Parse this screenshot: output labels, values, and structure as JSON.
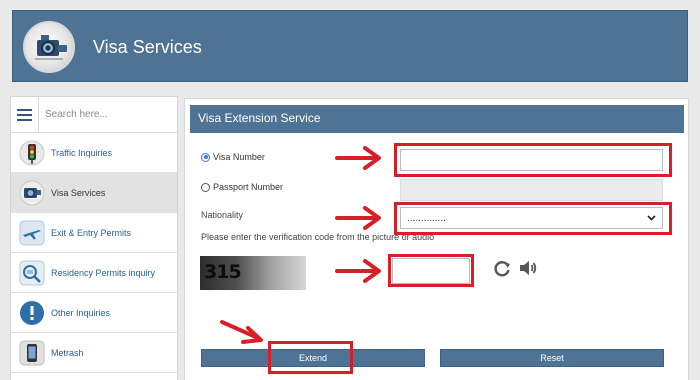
{
  "header": {
    "title": "Visa Services",
    "logo_icon": "camera-logo-icon",
    "color": "#4e7394"
  },
  "sidebar": {
    "menu_icon": "hamburger-icon",
    "search_placeholder": "Search here...",
    "items": [
      {
        "label": "Traffic Inquiries",
        "icon": "traffic-light-icon",
        "active": false
      },
      {
        "label": "Visa Services",
        "icon": "camera-icon",
        "active": true
      },
      {
        "label": "Exit & Entry Permits",
        "icon": "airplane-icon",
        "active": false
      },
      {
        "label": "Residency Permits inquiry",
        "icon": "id-card-icon",
        "active": false
      },
      {
        "label": "Other Inquiries",
        "icon": "info-icon",
        "active": false
      },
      {
        "label": "Metrash",
        "icon": "phone-icon",
        "active": false
      }
    ]
  },
  "form": {
    "title": "Visa Extension Service",
    "visa_number_label": "Visa Number",
    "passport_number_label": "Passport Number",
    "selected_option": "Visa Number",
    "nationality_label": "Nationality",
    "nationality_value": "..............",
    "verification_prompt": "Please enter the verification code from the picture or audio",
    "captcha_code": "315",
    "extend_label": "Extend",
    "reset_label": "Reset"
  },
  "annotation_color": "#d61f26"
}
